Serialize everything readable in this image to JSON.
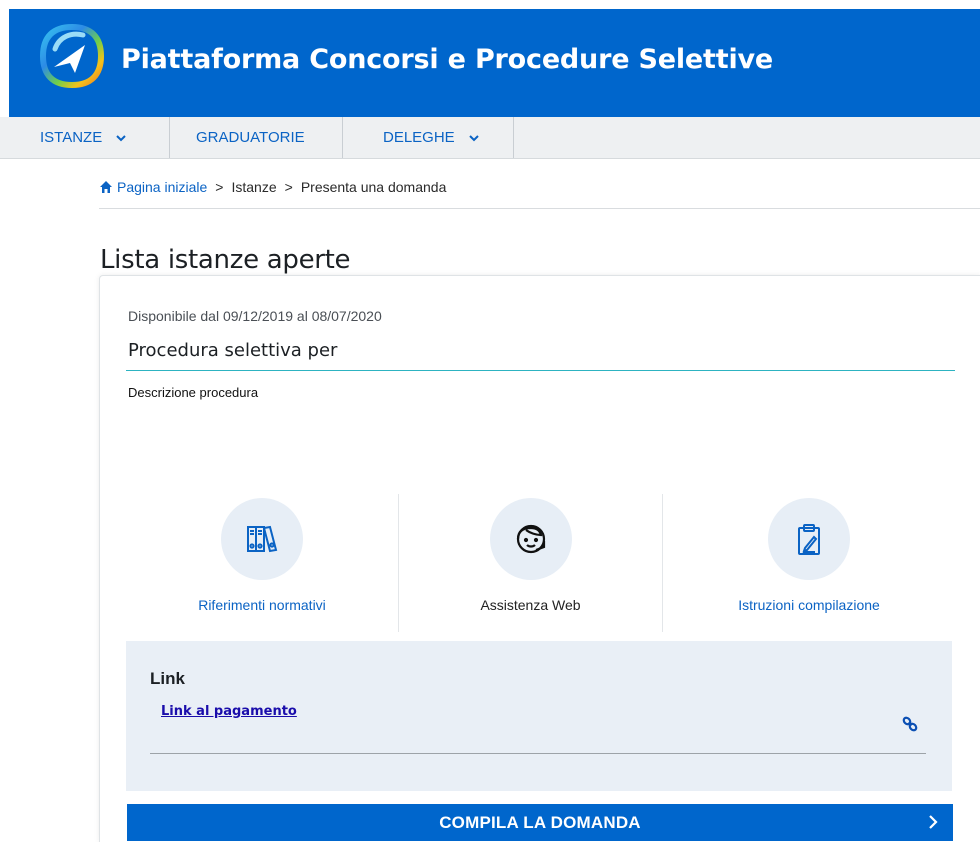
{
  "header": {
    "title": "Piattaforma Concorsi e Procedure Selettive"
  },
  "nav": {
    "items": [
      {
        "label": "ISTANZE",
        "has_dropdown": true
      },
      {
        "label": "GRADUATORIE",
        "has_dropdown": false
      },
      {
        "label": "DELEGHE",
        "has_dropdown": true
      }
    ]
  },
  "breadcrumb": {
    "home_icon": "home-icon",
    "home": "Pagina iniziale",
    "separator": ">",
    "level2": "Istanze",
    "current": "Presenta una domanda"
  },
  "page": {
    "title": "Lista istanze aperte"
  },
  "procedure": {
    "availability": "Disponibile dal 09/12/2019 al 08/07/2020",
    "title": "Procedura selettiva per",
    "description": "Descrizione procedura"
  },
  "actions": [
    {
      "icon": "binders-icon",
      "label": "Riferimenti normativi"
    },
    {
      "icon": "headset-icon",
      "label": "Assistenza Web"
    },
    {
      "icon": "clipboard-icon",
      "label": "Istruzioni compilazione"
    }
  ],
  "links": {
    "title": "Link",
    "items": [
      {
        "label": "Link al pagamento",
        "icon": "link-icon"
      }
    ]
  },
  "cta": {
    "label": "COMPILA LA DOMANDA",
    "icon": "chevron-right-icon"
  },
  "colors": {
    "brand": "#0066cc",
    "nav_bg": "#eef0f2",
    "accent_line": "#2db3c1",
    "link_box_bg": "#e9eff6",
    "icon_circle_bg": "#e7eef6"
  }
}
